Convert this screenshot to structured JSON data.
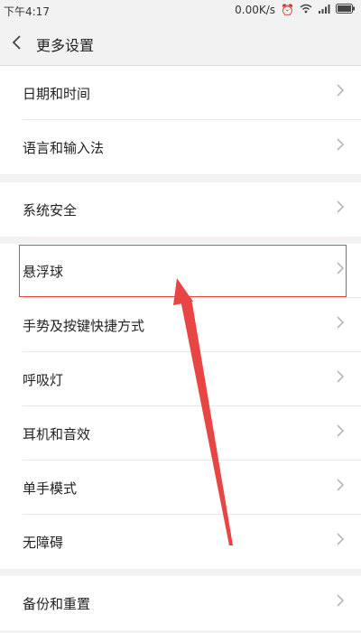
{
  "status_bar": {
    "time": "下午4:17",
    "speed": "0.00K/s"
  },
  "header": {
    "title": "更多设置"
  },
  "groups": [
    {
      "items": [
        "日期和时间",
        "语言和输入法"
      ]
    },
    {
      "items": [
        "系统安全"
      ]
    },
    {
      "items": [
        "悬浮球",
        "手势及按键快捷方式",
        "呼吸灯",
        "耳机和音效",
        "单手模式",
        "无障碍"
      ]
    },
    {
      "items": [
        "备份和重置"
      ]
    }
  ],
  "colors": {
    "highlight": "#e84545",
    "chevron": "#b8b8b8"
  }
}
